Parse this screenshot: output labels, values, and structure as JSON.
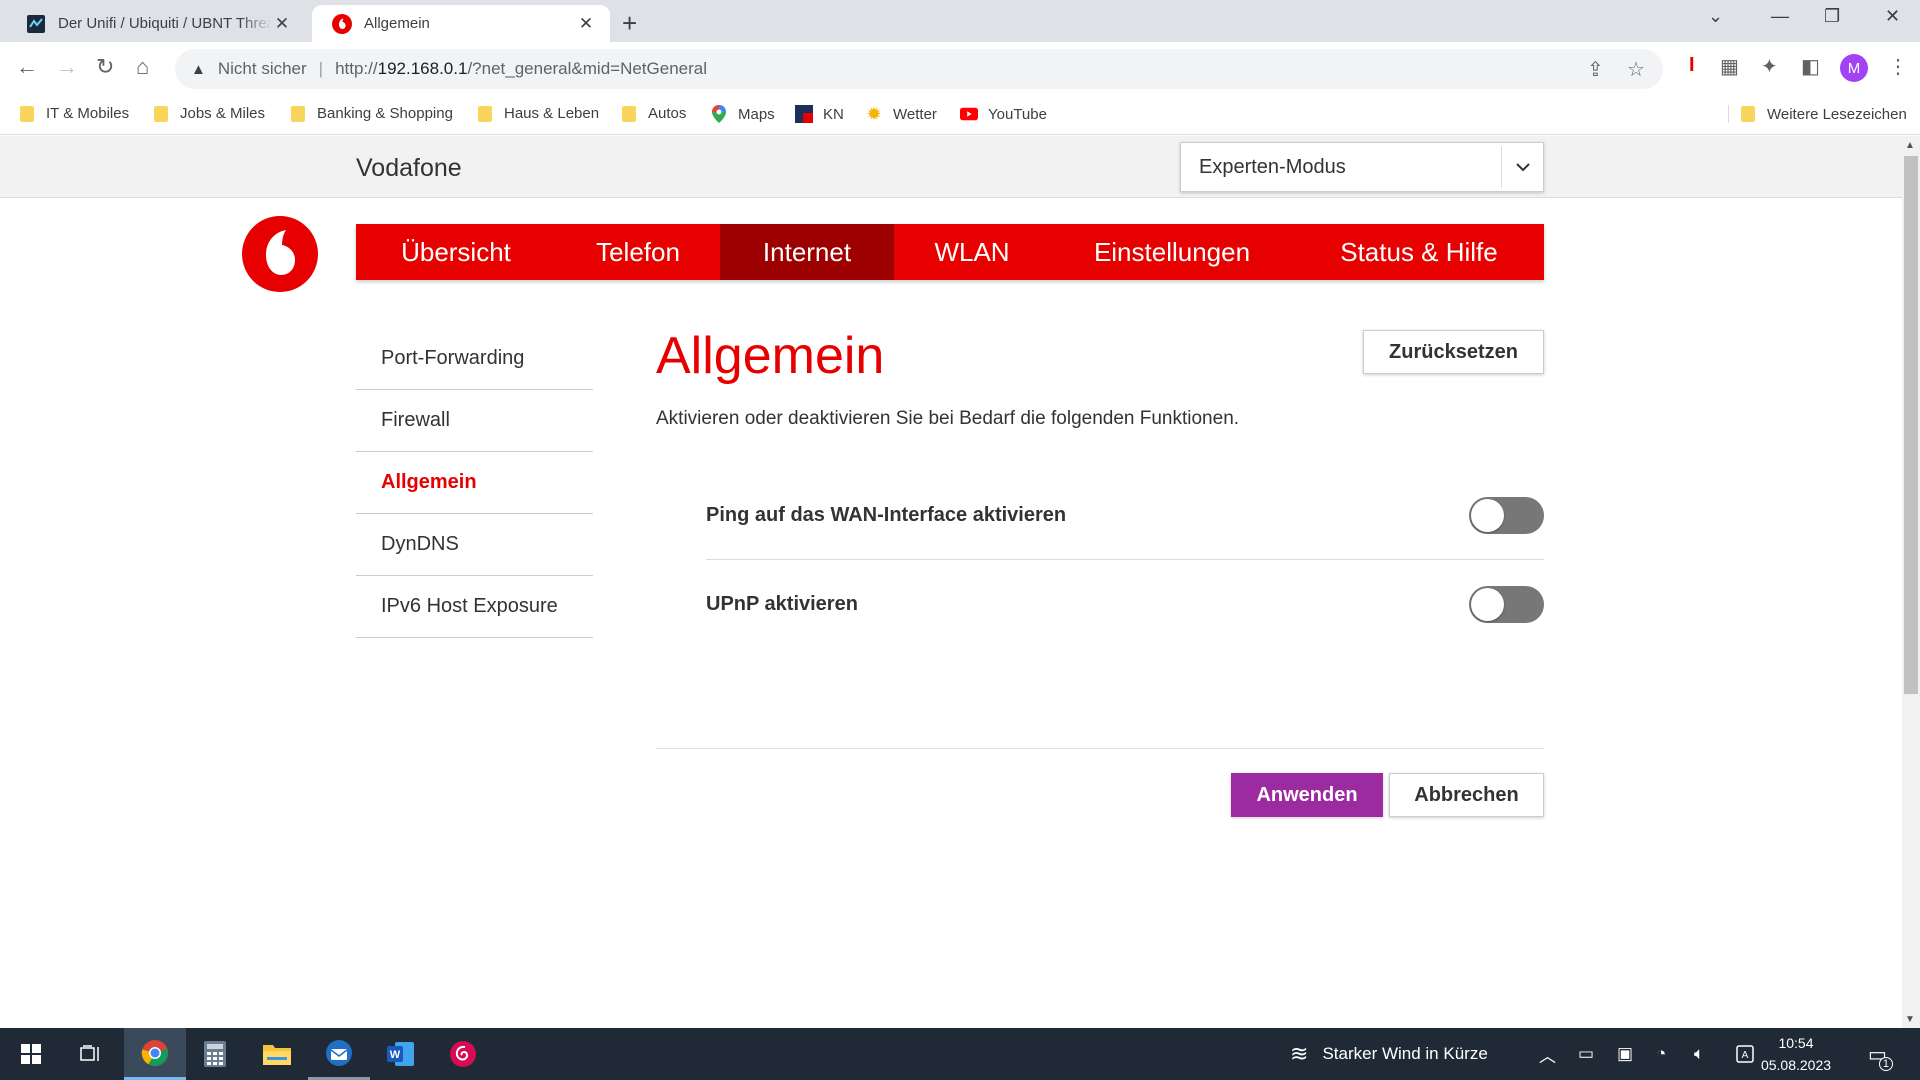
{
  "browser": {
    "tabs": [
      {
        "title": "Der Unifi / Ubiquiti / UBNT Thread",
        "active": false
      },
      {
        "title": "Allgemein",
        "active": true
      }
    ],
    "omnibox": {
      "security_label": "Nicht sicher",
      "url_prefix": "http://",
      "url_host": "192.168.0.1",
      "url_path": "/?net_general&mid=NetGeneral"
    },
    "profile_initial": "M",
    "bookmarks": [
      {
        "label": "IT & Mobiles",
        "icon": "folder-icon"
      },
      {
        "label": "Jobs & Miles",
        "icon": "folder-icon"
      },
      {
        "label": "Banking & Shopping",
        "icon": "folder-icon"
      },
      {
        "label": "Haus & Leben",
        "icon": "folder-icon"
      },
      {
        "label": "Autos",
        "icon": "folder-icon"
      },
      {
        "label": "Maps",
        "icon": "maps-icon"
      },
      {
        "label": "KN",
        "icon": "kn-icon"
      },
      {
        "label": "Wetter",
        "icon": "sun-icon"
      },
      {
        "label": "YouTube",
        "icon": "youtube-icon"
      }
    ],
    "other_bookmarks": "Weitere Lesezeichen"
  },
  "page": {
    "brand": "Vodafone",
    "mode_select": {
      "value": "Experten-Modus"
    },
    "main_nav": [
      {
        "label": "Übersicht",
        "active": false
      },
      {
        "label": "Telefon",
        "active": false
      },
      {
        "label": "Internet",
        "active": true
      },
      {
        "label": "WLAN",
        "active": false
      },
      {
        "label": "Einstellungen",
        "active": false
      },
      {
        "label": "Status & Hilfe",
        "active": false
      }
    ],
    "side_nav": [
      {
        "label": "Port-Forwarding",
        "active": false
      },
      {
        "label": "Firewall",
        "active": false
      },
      {
        "label": "Allgemein",
        "active": true
      },
      {
        "label": "DynDNS",
        "active": false
      },
      {
        "label": "IPv6 Host Exposure",
        "active": false
      }
    ],
    "heading": "Allgemein",
    "reset_label": "Zurücksetzen",
    "intro": "Aktivieren oder deaktivieren Sie bei Bedarf die folgenden Funktionen.",
    "options": [
      {
        "label": "Ping auf das WAN-Interface aktivieren",
        "enabled": false
      },
      {
        "label": "UPnP aktivieren",
        "enabled": false
      }
    ],
    "apply_label": "Anwenden",
    "cancel_label": "Abbrechen",
    "colors": {
      "brand_red": "#e60000",
      "active_nav": "#9c0000",
      "apply": "#9c2aa0",
      "toggle_off": "#777777"
    }
  },
  "taskbar": {
    "weather": "Starker Wind in Kürze",
    "time": "10:54",
    "date": "05.08.2023",
    "notification_count": "1"
  }
}
